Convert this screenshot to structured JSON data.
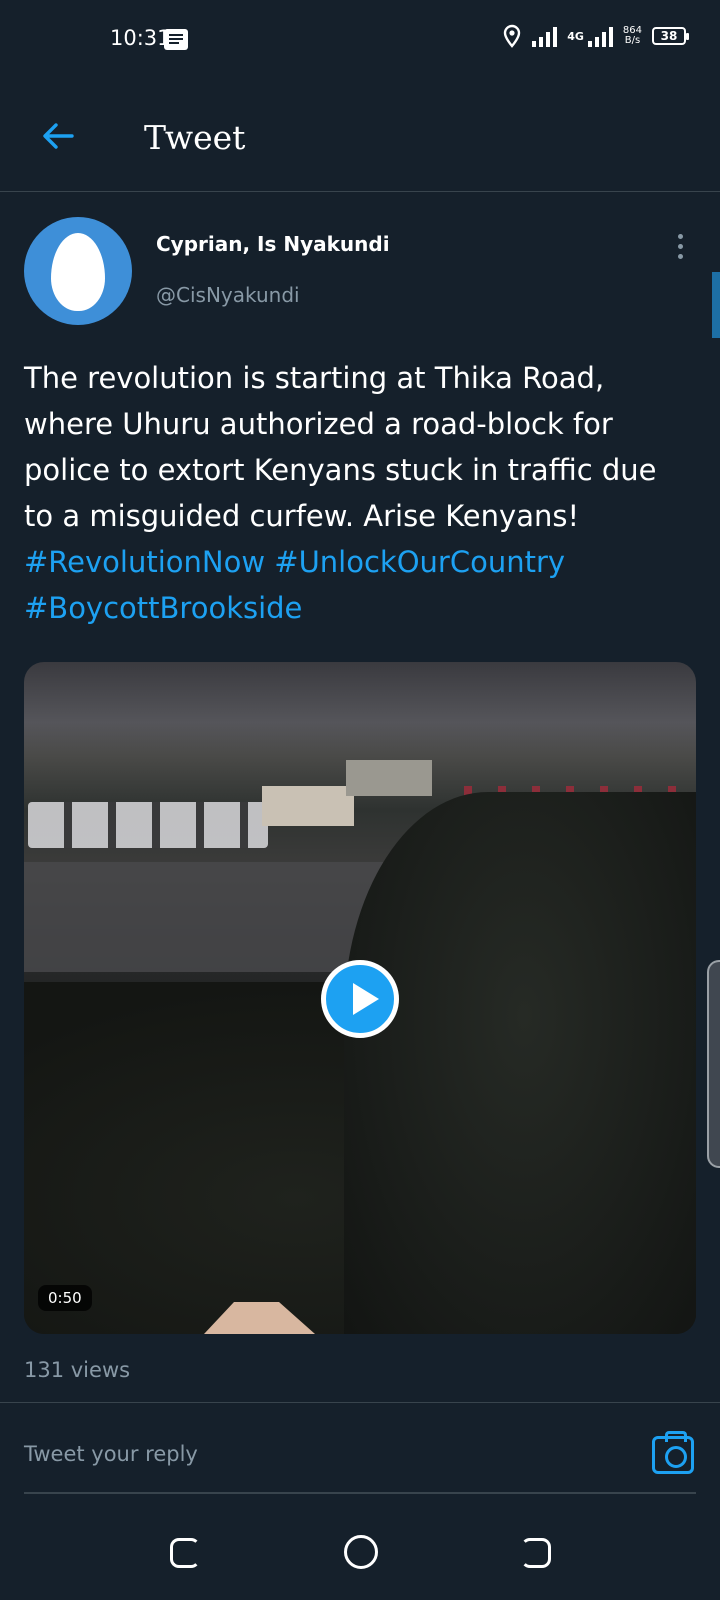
{
  "status_bar": {
    "time": "10:31",
    "network": "4G",
    "speed_value": "864",
    "speed_unit": "B/s",
    "battery": "38"
  },
  "header": {
    "title": "Tweet"
  },
  "tweet": {
    "author_name": "Cyprian, Is Nyakundi",
    "author_handle": "@CisNyakundi",
    "text": "The revolution is starting at Thika Road, where Uhuru authorized a road-block for police to extort Kenyans stuck in traffic due to a misguided curfew. Arise Kenyans!",
    "hashtags": [
      "#RevolutionNow",
      "#UnlockOurCountry",
      "#BoycottBrookside"
    ],
    "video_duration": "0:50",
    "views": "131 views"
  },
  "reply": {
    "placeholder": "Tweet your reply"
  },
  "colors": {
    "background": "#15202b",
    "accent": "#1da1f2",
    "muted": "#8899a6"
  },
  "icons": [
    "back-arrow-icon",
    "more-vertical-icon",
    "play-icon",
    "camera-icon",
    "location-icon",
    "signal-icon",
    "battery-icon",
    "message-icon"
  ]
}
